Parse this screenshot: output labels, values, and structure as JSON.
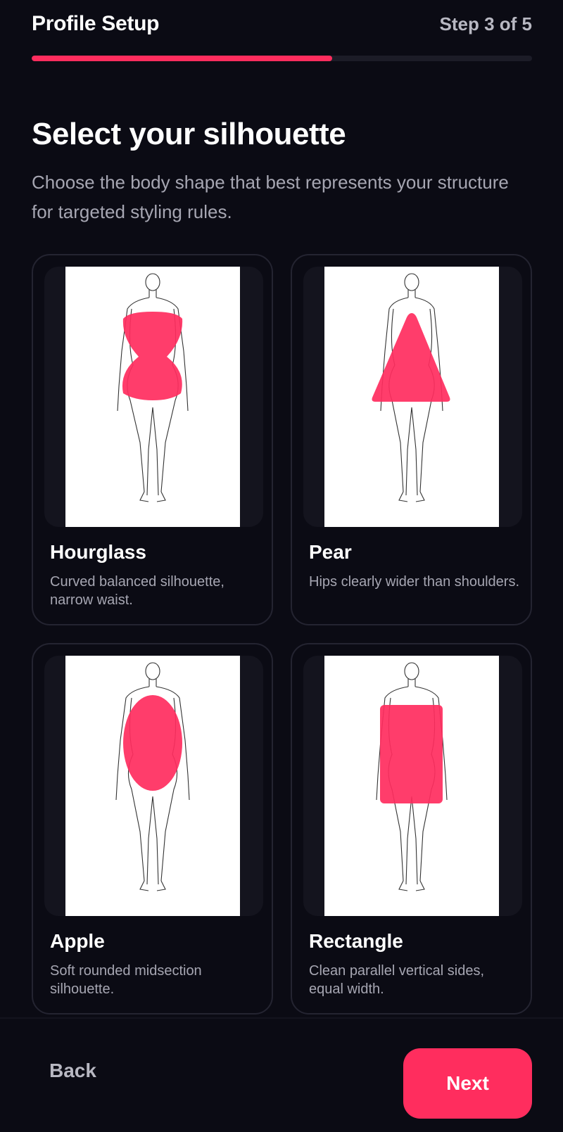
{
  "header": {
    "title": "Profile Setup",
    "step_label": "Step 3 of 5",
    "progress_fraction": 0.6
  },
  "page": {
    "title": "Select your silhouette",
    "subtitle": "Choose the body shape that best represents your structure for targeted styling rules."
  },
  "shapes": [
    {
      "name": "Hourglass",
      "description": "Curved balanced silhouette, narrow waist.",
      "icon": "hourglass-figure-icon"
    },
    {
      "name": "Pear",
      "description": "Hips clearly wider than shoulders.",
      "icon": "pear-figure-icon"
    },
    {
      "name": "Apple",
      "description": "Soft rounded midsection silhouette.",
      "icon": "apple-figure-icon"
    },
    {
      "name": "Rectangle",
      "description": "Clean parallel vertical sides, equal width.",
      "icon": "rectangle-figure-icon"
    }
  ],
  "footer": {
    "back_label": "Back",
    "next_label": "Next"
  },
  "colors": {
    "accent": "#ff2d5e",
    "background": "#0b0b14",
    "card_border": "#242431",
    "muted_text": "#a6a6b2"
  }
}
